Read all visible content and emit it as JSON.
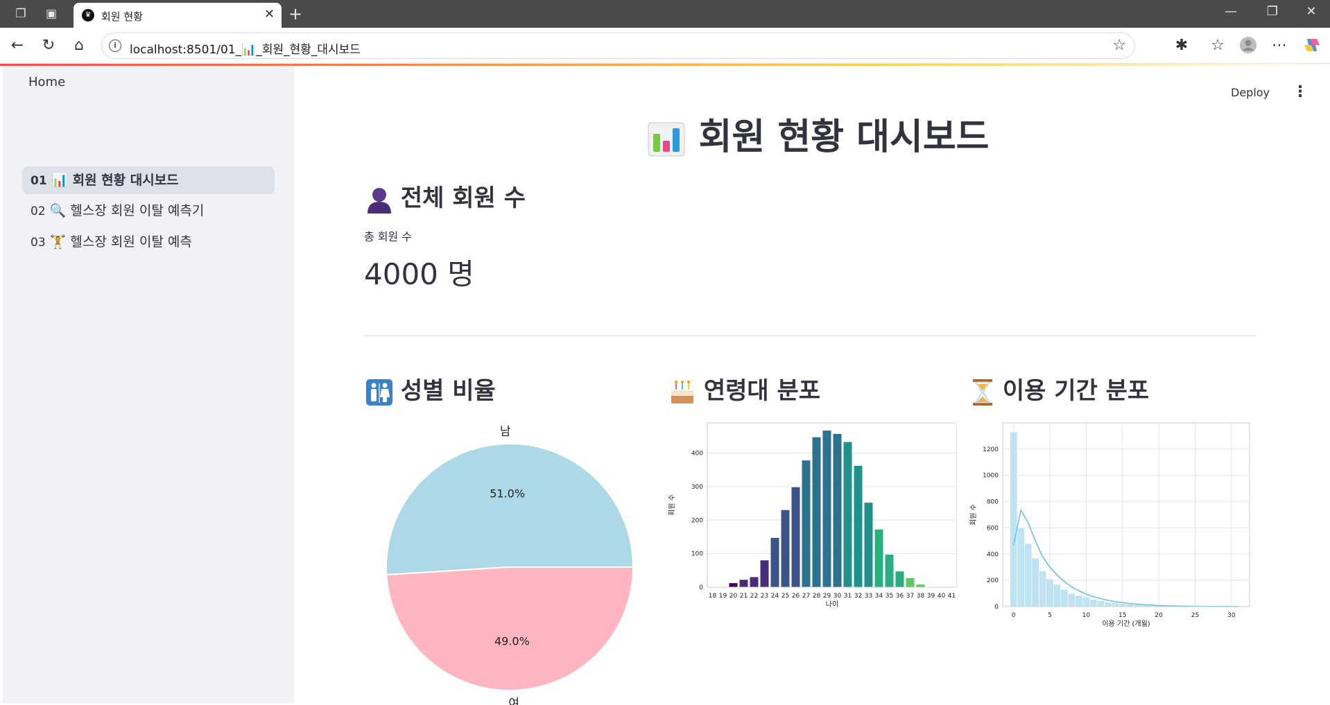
{
  "browser": {
    "tab_title": "회원 현황",
    "url": "localhost:8501/01_📊_회원_현황_대시보드"
  },
  "app": {
    "deploy_label": "Deploy"
  },
  "sidebar": {
    "home": "Home",
    "items": [
      {
        "num": "01",
        "emoji": "📊",
        "label": "회원 현황 대시보드",
        "active": true
      },
      {
        "num": "02",
        "emoji": "🔍",
        "label": "헬스장 회원 이탈 예측기",
        "active": false
      },
      {
        "num": "03",
        "emoji": "🏋️",
        "label": "헬스장 회원 이탈 예측",
        "active": false
      }
    ]
  },
  "page": {
    "title": "회원 현황 대시보드",
    "total_section_title": "전체 회원 수",
    "metric_label": "총 회원 수",
    "metric_value": "4000 명",
    "gender_title": "성별 비율",
    "age_title": "연령대 분포",
    "period_title": "이용 기간 분포"
  },
  "chart_data": [
    {
      "type": "pie",
      "labels": [
        "남",
        "여"
      ],
      "values": [
        51.0,
        49.0
      ],
      "value_labels": [
        "51.0%",
        "49.0%"
      ],
      "colors": [
        "#add8e6",
        "#ffb6c1"
      ]
    },
    {
      "type": "bar",
      "xlabel": "나이",
      "ylabel": "회원 수",
      "categories": [
        "18",
        "19",
        "20",
        "21",
        "22",
        "23",
        "24",
        "25",
        "26",
        "27",
        "28",
        "29",
        "30",
        "31",
        "32",
        "33",
        "34",
        "35",
        "36",
        "37",
        "38",
        "39",
        "40",
        "41"
      ],
      "values": [
        0,
        0,
        12,
        22,
        30,
        80,
        147,
        230,
        298,
        378,
        447,
        467,
        457,
        433,
        362,
        252,
        172,
        97,
        47,
        27,
        8,
        1,
        0,
        0
      ],
      "yticks": [
        0,
        100,
        200,
        300,
        400
      ],
      "ylim": [
        0,
        490
      ],
      "grid": true,
      "palette": "viridis"
    },
    {
      "type": "bar",
      "subtype": "histogram_with_kde",
      "xlabel": "이용 기간 (개월)",
      "ylabel": "회원 수",
      "bin_width": 1,
      "x": [
        0,
        1,
        2,
        3,
        4,
        5,
        6,
        7,
        8,
        9,
        10,
        11,
        12,
        13,
        14,
        15,
        16,
        17,
        18,
        19,
        20,
        21,
        22,
        23,
        24,
        25,
        26,
        27,
        28,
        29,
        30,
        31
      ],
      "values": [
        1330,
        600,
        480,
        370,
        270,
        210,
        170,
        130,
        100,
        85,
        70,
        55,
        45,
        35,
        28,
        22,
        18,
        14,
        10,
        8,
        6,
        5,
        4,
        3,
        2,
        2,
        1,
        1,
        1,
        1,
        1,
        0
      ],
      "kde": [
        470,
        735,
        640,
        500,
        380,
        300,
        240,
        190,
        150,
        120,
        95,
        75,
        60,
        48,
        38,
        30,
        23,
        18,
        14,
        11,
        8,
        6,
        5,
        4,
        3,
        2,
        2,
        1,
        1,
        1,
        1,
        0
      ],
      "xticks": [
        0,
        5,
        10,
        15,
        20,
        25,
        30
      ],
      "yticks": [
        0,
        200,
        400,
        600,
        800,
        1000,
        1200
      ],
      "xlim": [
        -1.5,
        32.5
      ],
      "ylim": [
        0,
        1400
      ],
      "grid": true,
      "color": "#87ceeb"
    }
  ]
}
